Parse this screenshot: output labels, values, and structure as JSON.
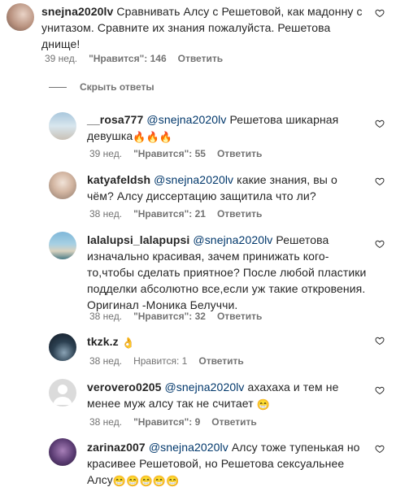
{
  "comments": [
    {
      "username": "snejna2020lv",
      "mention": "",
      "text": "Сравнивать Алсу с Решетовой, как мадонну с унитазом. Сравните их знания пожалуйста. Решетова днище!",
      "emoji": "",
      "time": "39 нед.",
      "likes": "\"Нравится\": 146",
      "reply": "Ответить"
    },
    {
      "username": "__rosa777",
      "mention": "@snejna2020lv",
      "text": "Решетова шикарная девушка",
      "emoji": "🔥🔥🔥",
      "time": "39 нед.",
      "likes": "\"Нравится\": 55",
      "reply": "Ответить"
    },
    {
      "username": "katyafeldsh",
      "mention": "@snejna2020lv",
      "text": "какие знания, вы о чём? Алсу диссертацию защитила что ли?",
      "emoji": "",
      "time": "38 нед.",
      "likes": "\"Нравится\": 21",
      "reply": "Ответить"
    },
    {
      "username": "lalalupsi_lalapupsi",
      "mention": "@snejna2020lv",
      "text": "Решетова изначально красивая, зачем принижать кого-то,чтобы сделать приятное? После любой пластики подделки абсолютно все,если уж такие откровения. Оригинал -Моника Белуччи.",
      "emoji": "",
      "time": "38 нед.",
      "likes": "\"Нравится\": 32",
      "reply": "Ответить"
    },
    {
      "username": "tkzk.z",
      "mention": "",
      "text": "",
      "emoji": "👌",
      "time": "38 нед.",
      "likes": "Нравится: 1",
      "reply": "Ответить"
    },
    {
      "username": "verovero0205",
      "mention": "@snejna2020lv",
      "text": "ахахаха и тем не менее муж алсу так не считает",
      "emoji": "😁",
      "time": "38 нед.",
      "likes": "\"Нравится\": 9",
      "reply": "Ответить"
    },
    {
      "username": "zarinaz007",
      "mention": "@snejna2020lv",
      "text": "Алсу тоже тупенькая но красивее Решетовой, но Решетова сексуальнее Алсу",
      "emoji": "😁😁😁😁😁",
      "time": "",
      "likes": "",
      "reply": ""
    }
  ],
  "hide_replies": "Скрыть ответы",
  "icons": {
    "like": "heart-outline-icon"
  },
  "colors": {
    "text": "#262626",
    "secondary": "#737373",
    "mention": "#00376b"
  }
}
